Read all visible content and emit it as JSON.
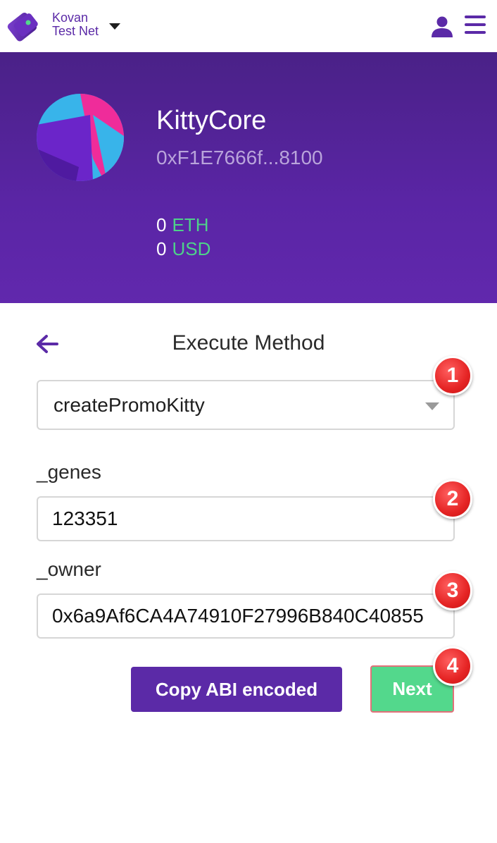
{
  "network": {
    "line1": "Kovan",
    "line2": "Test Net"
  },
  "contract": {
    "name": "KittyCore",
    "address": "0xF1E7666f...8100"
  },
  "balances": [
    {
      "amount": "0",
      "unit": "ETH"
    },
    {
      "amount": "0",
      "unit": "USD"
    }
  ],
  "form": {
    "title": "Execute Method",
    "method": "createPromoKitty",
    "fields": [
      {
        "label": "_genes",
        "value": "123351"
      },
      {
        "label": "_owner",
        "value": "0x6a9Af6CA4A74910F27996B840C40855"
      }
    ],
    "copy_abi_label": "Copy ABI encoded",
    "next_label": "Next"
  },
  "markers": [
    "1",
    "2",
    "3",
    "4"
  ],
  "colors": {
    "brand": "#5b2aa7",
    "accent_green": "#53d88c",
    "marker_red": "#e52424"
  },
  "icons": [
    "wallet-logo-icon",
    "chevron-down-icon",
    "account-icon",
    "hamburger-menu-icon",
    "back-arrow-icon",
    "dropdown-caret-icon"
  ]
}
